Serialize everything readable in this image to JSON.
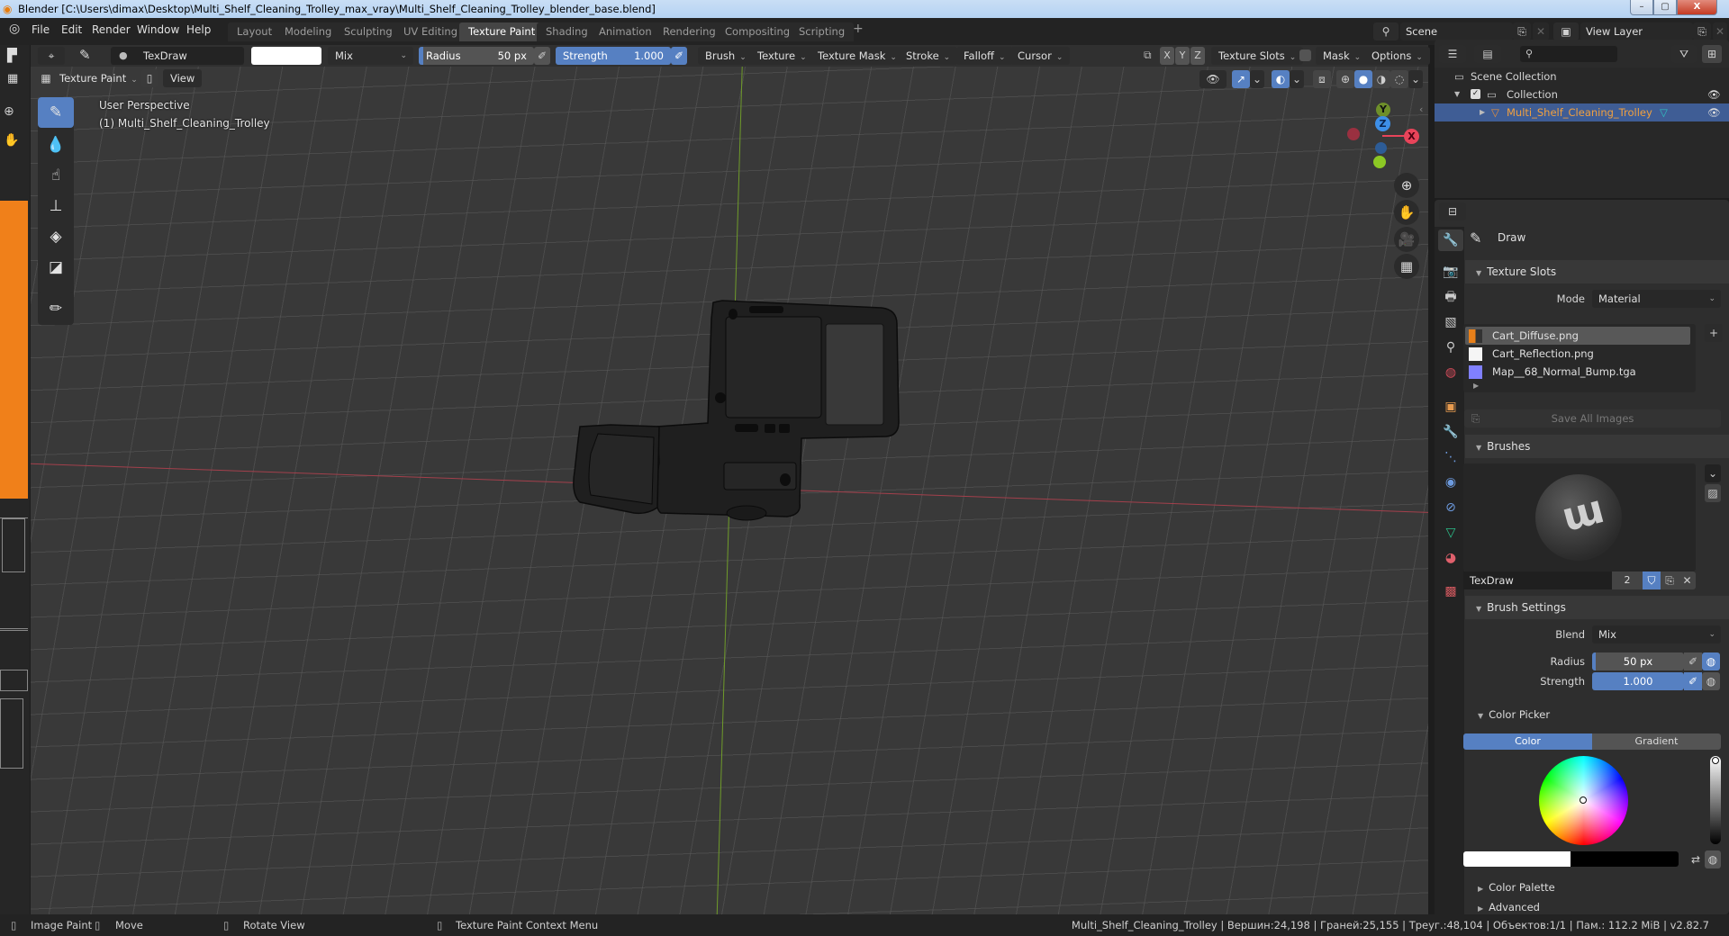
{
  "window": {
    "title": "Blender [C:\\Users\\dimax\\Desktop\\Multi_Shelf_Cleaning_Trolley_max_vray\\Multi_Shelf_Cleaning_Trolley_blender_base.blend]",
    "min_label": "–",
    "max_label": "▢",
    "close_label": "X"
  },
  "menu": {
    "items": [
      "File",
      "Edit",
      "Render",
      "Window",
      "Help"
    ]
  },
  "workspaces": {
    "tabs": [
      "Layout",
      "Modeling",
      "Sculpting",
      "UV Editing",
      "Texture Paint",
      "Shading",
      "Animation",
      "Rendering",
      "Compositing",
      "Scripting"
    ],
    "active": "Texture Paint",
    "add_label": "+"
  },
  "scene": {
    "scene_name": "Scene",
    "view_layer": "View Layer"
  },
  "tool_header": {
    "brush_name": "TexDraw",
    "color_hex": "#ffffff",
    "blend": "Mix",
    "radius_label": "Radius",
    "radius_value": "50 px",
    "radius_fraction": 0.04,
    "strength_label": "Strength",
    "strength_value": "1.000",
    "strength_fraction": 1.0,
    "menus": [
      "Brush",
      "Texture",
      "Texture Mask",
      "Stroke",
      "Falloff",
      "Cursor"
    ],
    "axes": [
      "X",
      "Y",
      "Z"
    ],
    "texture_slots_label": "Texture Slots",
    "mask_label": "Mask",
    "options_label": "Options"
  },
  "viewport_header": {
    "mode": "Texture Paint",
    "view_label": "View"
  },
  "viewport": {
    "perspective": "User Perspective",
    "object_label": "(1) Multi_Shelf_Cleaning_Trolley",
    "gizmo": {
      "x": "X",
      "y": "Y",
      "z": "Z"
    },
    "colors": {
      "x_axis": "#e8445a",
      "y_axis": "#8cc824",
      "z_axis": "#3d8fe8"
    }
  },
  "outliner": {
    "scene_collection": "Scene Collection",
    "collection": "Collection",
    "object": "Multi_Shelf_Cleaning_Trolley"
  },
  "properties": {
    "tool_name": "Draw",
    "texture_slots": {
      "title": "Texture Slots",
      "mode_label": "Mode",
      "mode_value": "Material",
      "slots": [
        "Cart_Diffuse.png",
        "Cart_Reflection.png",
        "Map__68_Normal_Bump.tga"
      ],
      "selected": 0,
      "save_all": "Save All Images"
    },
    "brushes": {
      "title": "Brushes",
      "brush_name": "TexDraw",
      "users": "2"
    },
    "brush_settings": {
      "title": "Brush Settings",
      "blend_label": "Blend",
      "blend_value": "Mix",
      "radius_label": "Radius",
      "radius_value": "50 px",
      "strength_label": "Strength",
      "strength_value": "1.000"
    },
    "color_picker": {
      "title": "Color Picker",
      "tab_color": "Color",
      "tab_gradient": "Gradient",
      "primary_color": "#ffffff",
      "secondary_color": "#000000",
      "value_fraction": 1.0
    },
    "color_palette": "Color Palette",
    "advanced": "Advanced"
  },
  "statusbar": {
    "hints": [
      "Image Paint",
      "Move",
      "Rotate View",
      "Texture Paint Context Menu"
    ],
    "stats": "Multi_Shelf_Cleaning_Trolley | Вершин:24,198 | Граней:25,155 | Треуг.:48,104 | Объектов:1/1 | Пам.: 112.2 MiB | v2.82.7"
  }
}
